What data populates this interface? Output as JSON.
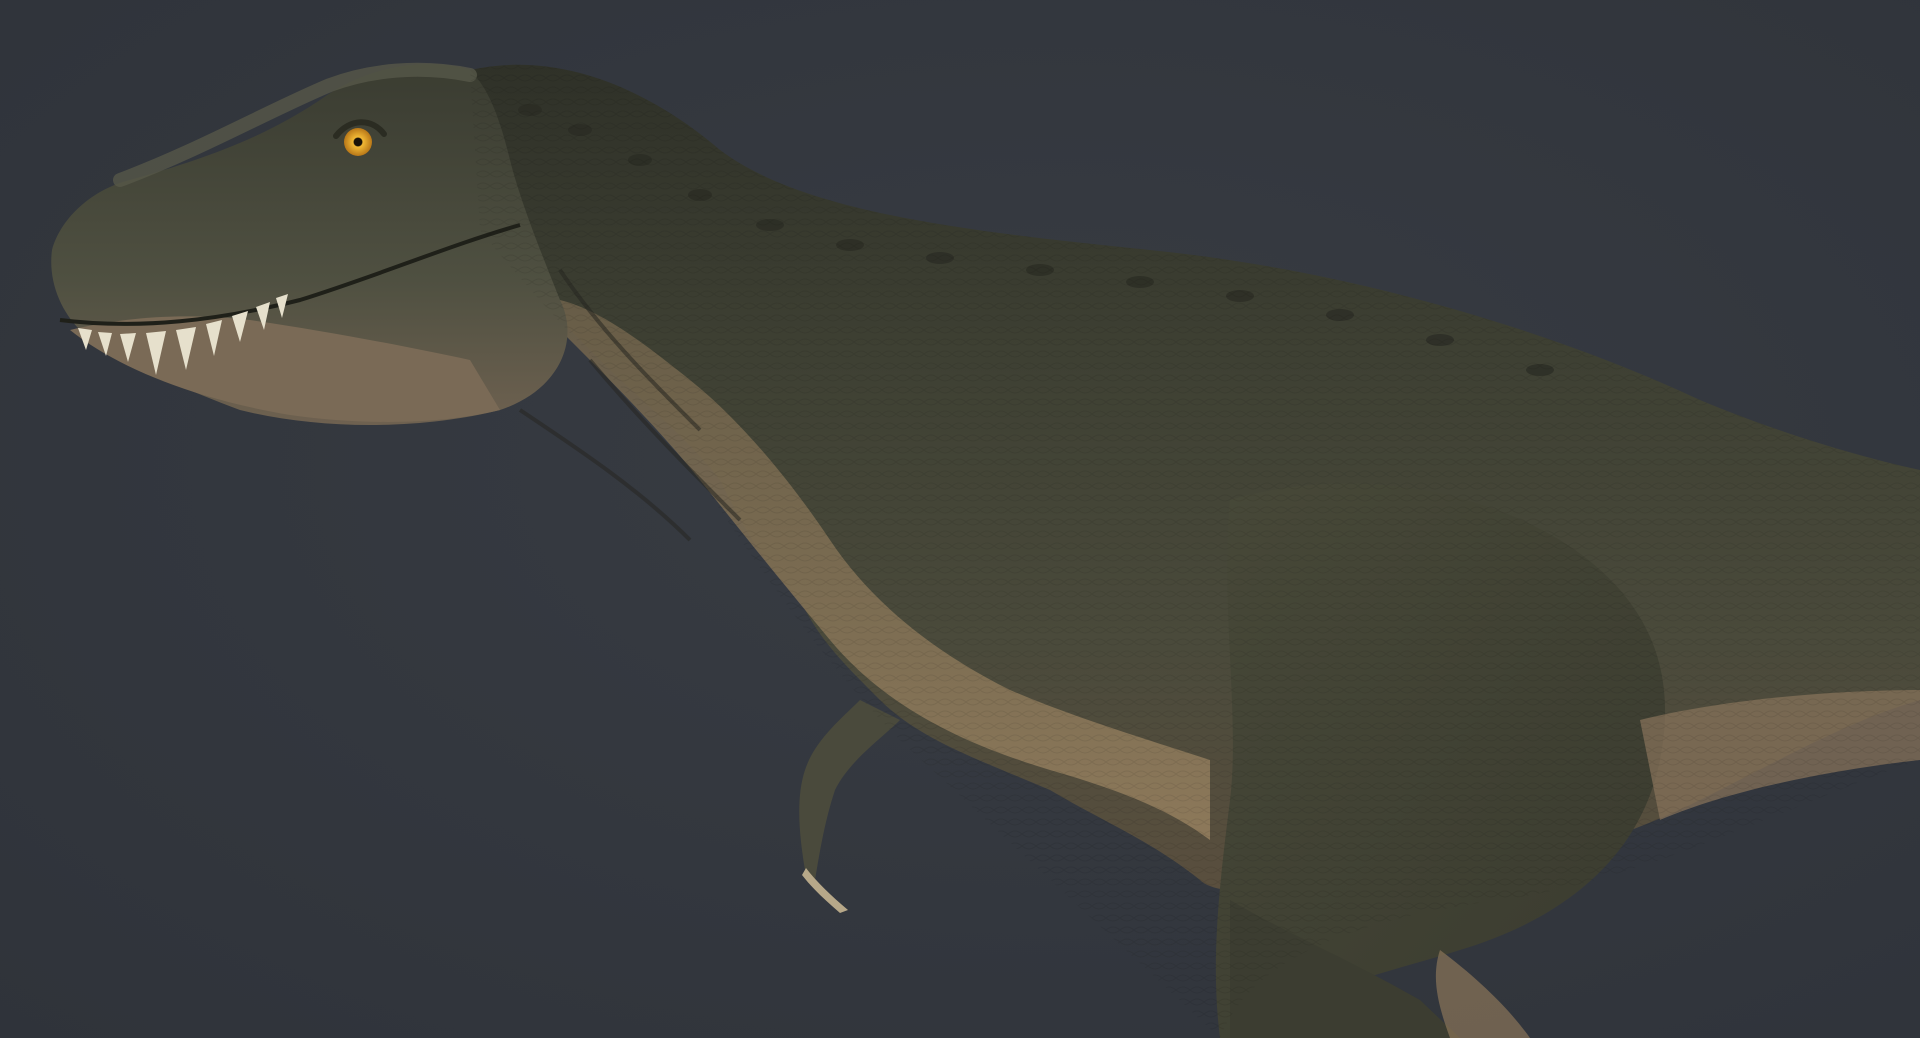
{
  "scene": {
    "subject_icon": "dinosaur-icon",
    "colors": {
      "background": "#33373e",
      "skin_dark": "#3b3c30",
      "skin_mid": "#4d4d3e",
      "belly": "#8a7559",
      "teeth": "#e6e0cc",
      "eye": "#e0a42a"
    }
  }
}
